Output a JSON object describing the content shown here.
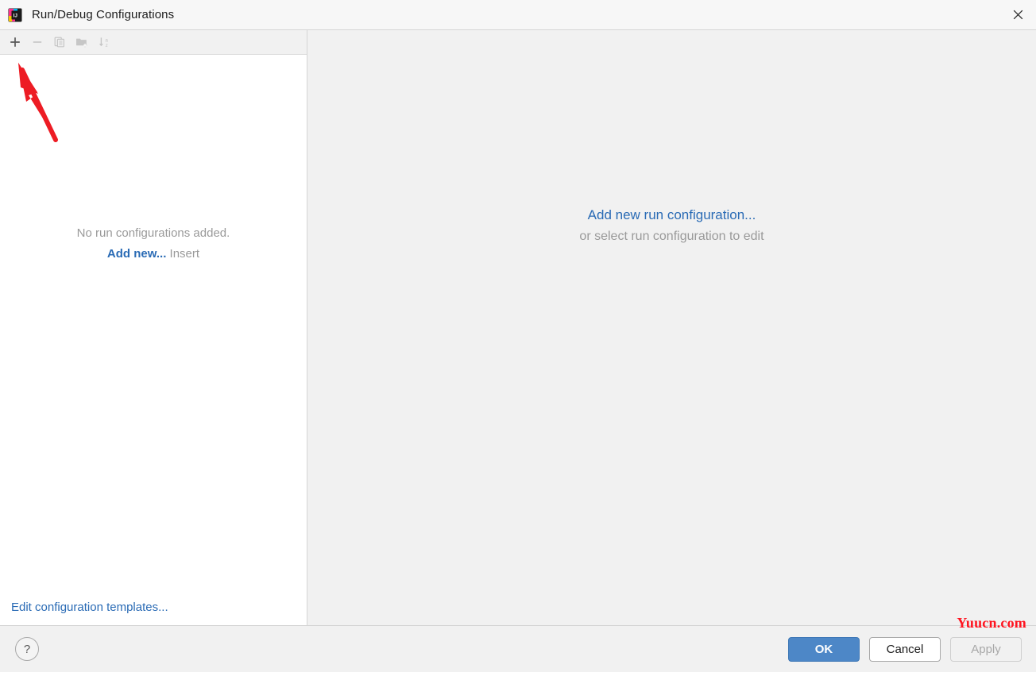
{
  "window": {
    "title": "Run/Debug Configurations",
    "app_icon": "intellij-idea-logo",
    "close_icon": "close-icon"
  },
  "toolbar": {
    "buttons": [
      {
        "name": "add-configuration-button",
        "icon": "plus-icon",
        "label": "+",
        "enabled": true
      },
      {
        "name": "remove-configuration-button",
        "icon": "minus-icon",
        "label": "−",
        "enabled": false
      },
      {
        "name": "copy-configuration-button",
        "icon": "copy-icon",
        "label": "Copy Configuration",
        "enabled": false
      },
      {
        "name": "create-folder-button",
        "icon": "folder-add-icon",
        "label": "Create New Folder",
        "enabled": false
      },
      {
        "name": "sort-configurations-button",
        "icon": "sort-alphabetically-icon",
        "label": "Sort Configurations",
        "enabled": false
      }
    ]
  },
  "left_panel": {
    "empty_message": "No run configurations added.",
    "add_new_link": "Add new...",
    "add_new_shortcut": "Insert",
    "edit_templates_link": "Edit configuration templates..."
  },
  "right_panel": {
    "primary_link": "Add new run configuration...",
    "secondary_text": "or select run configuration to edit"
  },
  "footer": {
    "help_label": "?",
    "ok_label": "OK",
    "cancel_label": "Cancel",
    "apply_label": "Apply"
  },
  "annotation": {
    "arrow_color": "#ed1c24",
    "arrow_target": "add-configuration-button"
  },
  "watermark": {
    "text": "Yuucn.com",
    "color": "#ff1420"
  },
  "colors": {
    "accent_link": "#2a6bb5",
    "primary_button": "#4d87c7",
    "panel_background": "#f1f1f1",
    "list_background": "#ffffff",
    "muted_text": "#9a9a9a"
  }
}
